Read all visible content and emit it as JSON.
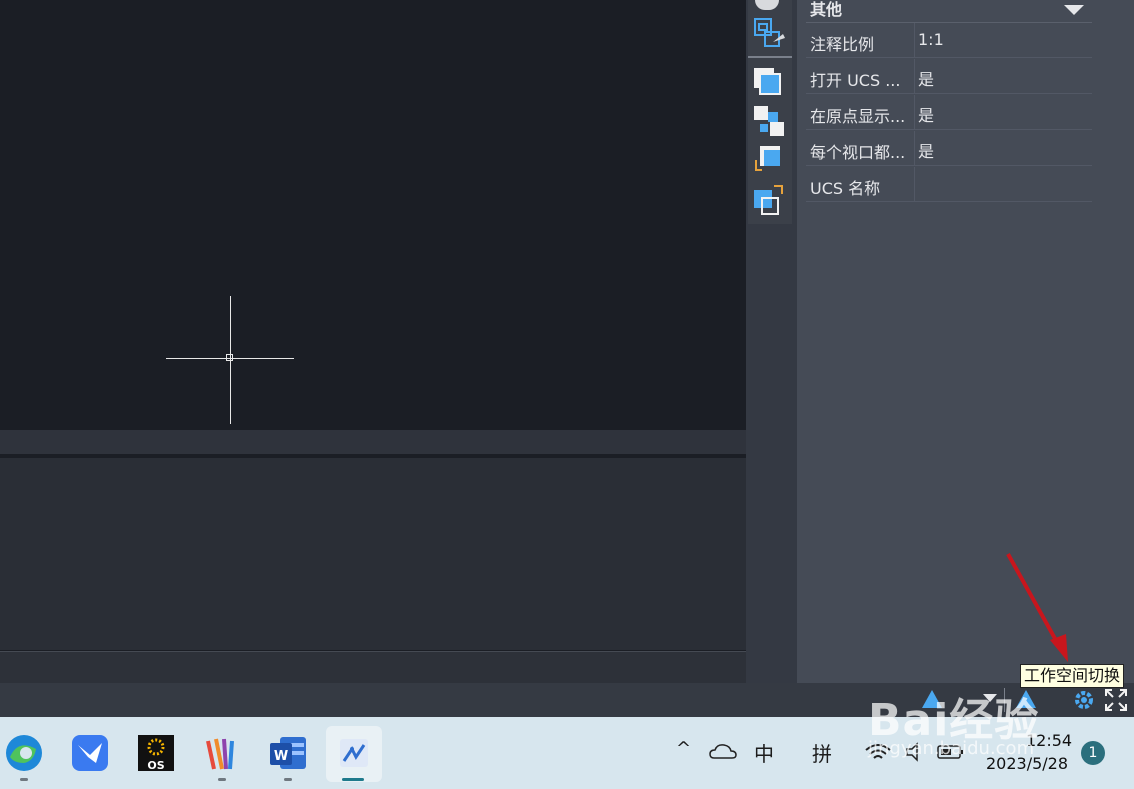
{
  "properties": {
    "section_title": "其他",
    "rows": [
      {
        "label": "注释比例",
        "value": "1:1"
      },
      {
        "label": "打开 UCS ...",
        "value": "是"
      },
      {
        "label": "在原点显示...",
        "value": "是"
      },
      {
        "label": "每个视口都...",
        "value": "是"
      },
      {
        "label": "UCS 名称",
        "value": ""
      }
    ]
  },
  "status_bar": {
    "tooltip": "工作空间切换",
    "icons": [
      "annotation-scale-icon",
      "annotation-visibility-icon",
      "workspace-gear-icon",
      "fullscreen-icon"
    ]
  },
  "taskbar": {
    "apps": [
      "edge-icon",
      "feishu-icon",
      "os-app-icon",
      "colorful-app-icon",
      "word-icon",
      "cad-app-icon"
    ],
    "tray": {
      "chevron": "^",
      "ime_lang": "中",
      "ime_mode": "拼"
    },
    "time": "12:54",
    "date": "2023/5/28",
    "notification_count": "1"
  },
  "watermark": {
    "text": "Bai经验",
    "url": "jingyan.baidu.com"
  },
  "colors": {
    "canvas_bg": "#1b1e25",
    "panel_bg": "#454b56",
    "tool_blue": "#4aa8f0",
    "arrow_red": "#c8161d"
  }
}
